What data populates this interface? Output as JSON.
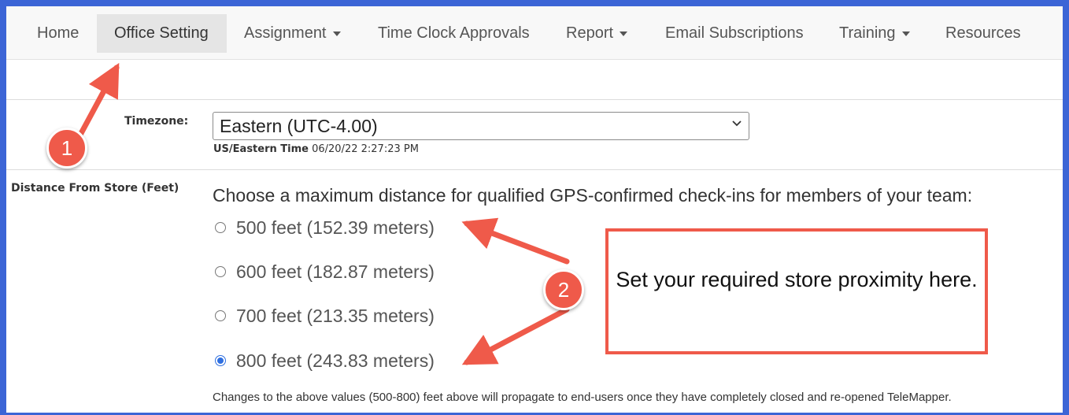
{
  "nav": {
    "items": [
      {
        "label": "Home",
        "dropdown": false,
        "active": false
      },
      {
        "label": "Office Setting",
        "dropdown": false,
        "active": true
      },
      {
        "label": "Assignment",
        "dropdown": true,
        "active": false
      },
      {
        "label": "Time Clock Approvals",
        "dropdown": false,
        "active": false
      },
      {
        "label": "Report",
        "dropdown": true,
        "active": false
      },
      {
        "label": "Email Subscriptions",
        "dropdown": false,
        "active": false
      },
      {
        "label": "Training",
        "dropdown": true,
        "active": false
      },
      {
        "label": "Resources",
        "dropdown": false,
        "active": false
      }
    ]
  },
  "timezone": {
    "label": "Timezone:",
    "selected": "Eastern (UTC-4.00)",
    "tz_name": "US/Eastern Time",
    "datetime": "06/20/22 2:27:23 PM"
  },
  "distance": {
    "label": "Distance From Store (Feet)",
    "prompt": "Choose a maximum distance for qualified GPS-confirmed check-ins for members of your team:",
    "options": [
      {
        "label": "500 feet (152.39 meters)",
        "checked": false
      },
      {
        "label": "600 feet (182.87 meters)",
        "checked": false
      },
      {
        "label": "700 feet (213.35 meters)",
        "checked": false
      },
      {
        "label": "800 feet (243.83 meters)",
        "checked": true
      }
    ],
    "note": "Changes to the above values (500-800) feet above will propagate to end-users once they have completely closed and re-opened TeleMapper."
  },
  "annotations": {
    "badge1": "1",
    "badge2": "2",
    "callout": "Set your required store proximity here.",
    "accent_color": "#ef5a4a"
  }
}
